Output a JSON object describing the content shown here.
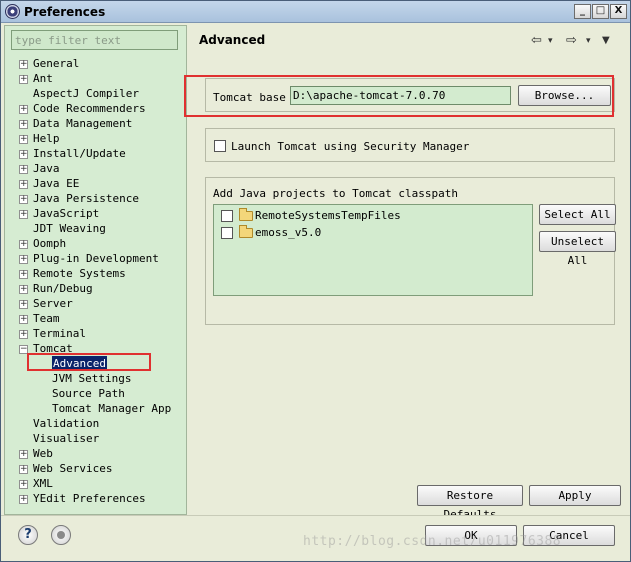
{
  "window": {
    "title": "Preferences",
    "controls": {
      "minimize": "_",
      "maximize": "□",
      "close": "X"
    }
  },
  "filter": {
    "placeholder": "type filter text",
    "value": ""
  },
  "tree": [
    {
      "label": "General",
      "expander": "+",
      "indent": 0
    },
    {
      "label": "Ant",
      "expander": "+",
      "indent": 0
    },
    {
      "label": "AspectJ Compiler",
      "expander": "",
      "indent": 0
    },
    {
      "label": "Code Recommenders",
      "expander": "+",
      "indent": 0
    },
    {
      "label": "Data Management",
      "expander": "+",
      "indent": 0
    },
    {
      "label": "Help",
      "expander": "+",
      "indent": 0
    },
    {
      "label": "Install/Update",
      "expander": "+",
      "indent": 0
    },
    {
      "label": "Java",
      "expander": "+",
      "indent": 0
    },
    {
      "label": "Java EE",
      "expander": "+",
      "indent": 0
    },
    {
      "label": "Java Persistence",
      "expander": "+",
      "indent": 0
    },
    {
      "label": "JavaScript",
      "expander": "+",
      "indent": 0
    },
    {
      "label": "JDT Weaving",
      "expander": "",
      "indent": 0
    },
    {
      "label": "Oomph",
      "expander": "+",
      "indent": 0
    },
    {
      "label": "Plug-in Development",
      "expander": "+",
      "indent": 0
    },
    {
      "label": "Remote Systems",
      "expander": "+",
      "indent": 0
    },
    {
      "label": "Run/Debug",
      "expander": "+",
      "indent": 0
    },
    {
      "label": "Server",
      "expander": "+",
      "indent": 0
    },
    {
      "label": "Team",
      "expander": "+",
      "indent": 0
    },
    {
      "label": "Terminal",
      "expander": "+",
      "indent": 0
    },
    {
      "label": "Tomcat",
      "expander": "−",
      "indent": 0
    },
    {
      "label": "Advanced",
      "expander": "",
      "indent": 1,
      "selected": true
    },
    {
      "label": "JVM Settings",
      "expander": "",
      "indent": 1
    },
    {
      "label": "Source Path",
      "expander": "",
      "indent": 1
    },
    {
      "label": "Tomcat Manager App",
      "expander": "",
      "indent": 1
    },
    {
      "label": "Validation",
      "expander": "",
      "indent": 0
    },
    {
      "label": "Visualiser",
      "expander": "",
      "indent": 0
    },
    {
      "label": "Web",
      "expander": "+",
      "indent": 0
    },
    {
      "label": "Web Services",
      "expander": "+",
      "indent": 0
    },
    {
      "label": "XML",
      "expander": "+",
      "indent": 0
    },
    {
      "label": "YEdit Preferences",
      "expander": "+",
      "indent": 0
    }
  ],
  "page": {
    "title": "Advanced",
    "nav": {
      "back": "⇦",
      "back_menu": "▾",
      "forward": "⇨",
      "forward_menu": "▾",
      "view_menu": "▼"
    },
    "tomcat_base": {
      "label": "Tomcat base",
      "value": "D:\\apache-tomcat-7.0.70",
      "browse_label": "Browse..."
    },
    "security_manager": {
      "label": "Launch Tomcat using Security Manager",
      "checked": false
    },
    "classpath": {
      "label": "Add Java projects to Tomcat classpath",
      "projects": [
        {
          "name": "RemoteSystemsTempFiles",
          "checked": false
        },
        {
          "name": "emoss_v5.0",
          "checked": false
        }
      ],
      "select_all_label": "Select All",
      "unselect_all_label": "Unselect All"
    },
    "restore_defaults_label": "Restore Defaults",
    "apply_label": "Apply"
  },
  "footer": {
    "help_label": "?",
    "ok_label": "OK",
    "cancel_label": "Cancel",
    "watermark": "http://blog.csdn.net/u011976388"
  },
  "colors": {
    "highlight_box": "#e03030",
    "selection": "#0a246a",
    "tree_bg": "#d6ecd2"
  }
}
